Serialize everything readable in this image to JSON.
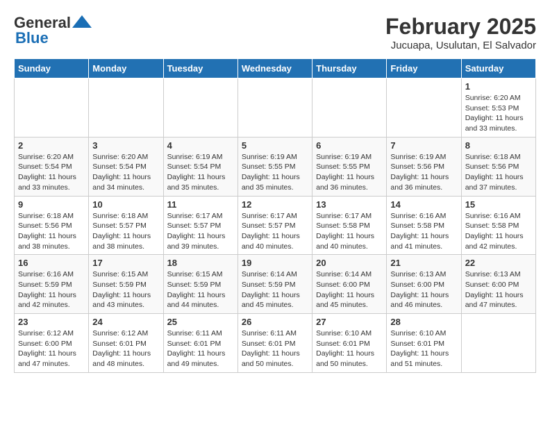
{
  "header": {
    "logo_line1": "General",
    "logo_line2": "Blue",
    "title": "February 2025",
    "subtitle": "Jucuapa, Usulutan, El Salvador"
  },
  "days_of_week": [
    "Sunday",
    "Monday",
    "Tuesday",
    "Wednesday",
    "Thursday",
    "Friday",
    "Saturday"
  ],
  "weeks": [
    [
      {
        "day": "",
        "info": ""
      },
      {
        "day": "",
        "info": ""
      },
      {
        "day": "",
        "info": ""
      },
      {
        "day": "",
        "info": ""
      },
      {
        "day": "",
        "info": ""
      },
      {
        "day": "",
        "info": ""
      },
      {
        "day": "1",
        "info": "Sunrise: 6:20 AM\nSunset: 5:53 PM\nDaylight: 11 hours\nand 33 minutes."
      }
    ],
    [
      {
        "day": "2",
        "info": "Sunrise: 6:20 AM\nSunset: 5:54 PM\nDaylight: 11 hours\nand 33 minutes."
      },
      {
        "day": "3",
        "info": "Sunrise: 6:20 AM\nSunset: 5:54 PM\nDaylight: 11 hours\nand 34 minutes."
      },
      {
        "day": "4",
        "info": "Sunrise: 6:19 AM\nSunset: 5:54 PM\nDaylight: 11 hours\nand 35 minutes."
      },
      {
        "day": "5",
        "info": "Sunrise: 6:19 AM\nSunset: 5:55 PM\nDaylight: 11 hours\nand 35 minutes."
      },
      {
        "day": "6",
        "info": "Sunrise: 6:19 AM\nSunset: 5:55 PM\nDaylight: 11 hours\nand 36 minutes."
      },
      {
        "day": "7",
        "info": "Sunrise: 6:19 AM\nSunset: 5:56 PM\nDaylight: 11 hours\nand 36 minutes."
      },
      {
        "day": "8",
        "info": "Sunrise: 6:18 AM\nSunset: 5:56 PM\nDaylight: 11 hours\nand 37 minutes."
      }
    ],
    [
      {
        "day": "9",
        "info": "Sunrise: 6:18 AM\nSunset: 5:56 PM\nDaylight: 11 hours\nand 38 minutes."
      },
      {
        "day": "10",
        "info": "Sunrise: 6:18 AM\nSunset: 5:57 PM\nDaylight: 11 hours\nand 38 minutes."
      },
      {
        "day": "11",
        "info": "Sunrise: 6:17 AM\nSunset: 5:57 PM\nDaylight: 11 hours\nand 39 minutes."
      },
      {
        "day": "12",
        "info": "Sunrise: 6:17 AM\nSunset: 5:57 PM\nDaylight: 11 hours\nand 40 minutes."
      },
      {
        "day": "13",
        "info": "Sunrise: 6:17 AM\nSunset: 5:58 PM\nDaylight: 11 hours\nand 40 minutes."
      },
      {
        "day": "14",
        "info": "Sunrise: 6:16 AM\nSunset: 5:58 PM\nDaylight: 11 hours\nand 41 minutes."
      },
      {
        "day": "15",
        "info": "Sunrise: 6:16 AM\nSunset: 5:58 PM\nDaylight: 11 hours\nand 42 minutes."
      }
    ],
    [
      {
        "day": "16",
        "info": "Sunrise: 6:16 AM\nSunset: 5:59 PM\nDaylight: 11 hours\nand 42 minutes."
      },
      {
        "day": "17",
        "info": "Sunrise: 6:15 AM\nSunset: 5:59 PM\nDaylight: 11 hours\nand 43 minutes."
      },
      {
        "day": "18",
        "info": "Sunrise: 6:15 AM\nSunset: 5:59 PM\nDaylight: 11 hours\nand 44 minutes."
      },
      {
        "day": "19",
        "info": "Sunrise: 6:14 AM\nSunset: 5:59 PM\nDaylight: 11 hours\nand 45 minutes."
      },
      {
        "day": "20",
        "info": "Sunrise: 6:14 AM\nSunset: 6:00 PM\nDaylight: 11 hours\nand 45 minutes."
      },
      {
        "day": "21",
        "info": "Sunrise: 6:13 AM\nSunset: 6:00 PM\nDaylight: 11 hours\nand 46 minutes."
      },
      {
        "day": "22",
        "info": "Sunrise: 6:13 AM\nSunset: 6:00 PM\nDaylight: 11 hours\nand 47 minutes."
      }
    ],
    [
      {
        "day": "23",
        "info": "Sunrise: 6:12 AM\nSunset: 6:00 PM\nDaylight: 11 hours\nand 47 minutes."
      },
      {
        "day": "24",
        "info": "Sunrise: 6:12 AM\nSunset: 6:01 PM\nDaylight: 11 hours\nand 48 minutes."
      },
      {
        "day": "25",
        "info": "Sunrise: 6:11 AM\nSunset: 6:01 PM\nDaylight: 11 hours\nand 49 minutes."
      },
      {
        "day": "26",
        "info": "Sunrise: 6:11 AM\nSunset: 6:01 PM\nDaylight: 11 hours\nand 50 minutes."
      },
      {
        "day": "27",
        "info": "Sunrise: 6:10 AM\nSunset: 6:01 PM\nDaylight: 11 hours\nand 50 minutes."
      },
      {
        "day": "28",
        "info": "Sunrise: 6:10 AM\nSunset: 6:01 PM\nDaylight: 11 hours\nand 51 minutes."
      },
      {
        "day": "",
        "info": ""
      }
    ]
  ]
}
